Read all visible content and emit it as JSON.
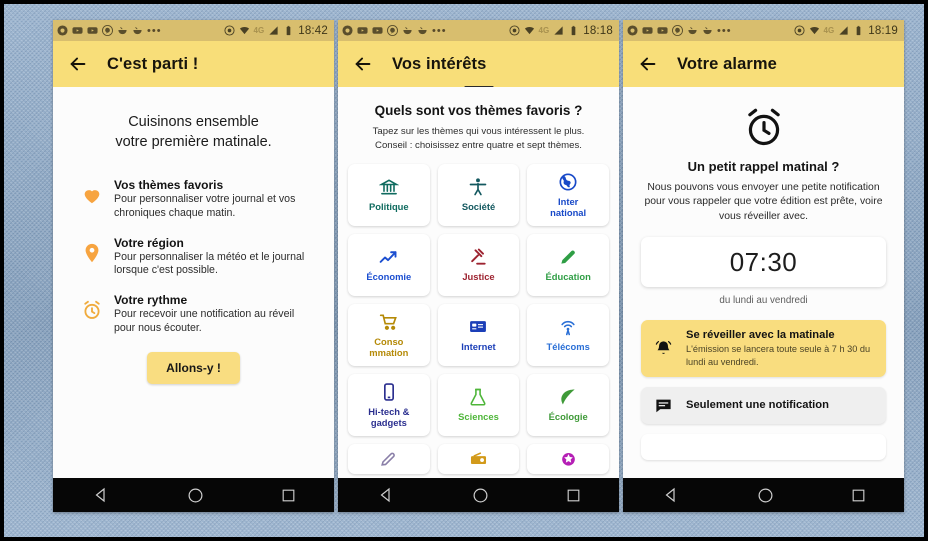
{
  "colors": {
    "accent_yellow": "#f8de79",
    "statusbar_yellow": "#d8be6e",
    "backdrop_blue": "#8fabc9",
    "navbar_black": "#060606"
  },
  "phones": [
    {
      "id": "phone-onboarding-intro",
      "statusbar": {
        "icons": [
          "chrome-icon",
          "youtube-icon",
          "youtube-icon",
          "pinterest-icon",
          "food-bowl-icon",
          "food-bowl-icon",
          "overflow-dots-icon"
        ],
        "network": "4G",
        "right_icons": [
          "do-not-disturb-icon",
          "wifi-icon",
          "signal-icon",
          "battery-icon"
        ],
        "time": "18:42"
      },
      "appbar": {
        "title": "C'est parti !",
        "back": "back-arrow-icon"
      },
      "intro": {
        "heading_line1": "Cuisinons ensemble",
        "heading_line2": "votre première matinale.",
        "features": [
          {
            "icon": "heart-icon",
            "title": "Vos thèmes favoris",
            "description": "Pour personnaliser votre journal et vos chroniques chaque matin."
          },
          {
            "icon": "location-pin-icon",
            "title": "Votre région",
            "description": "Pour personnaliser la météo et le journal lorsque c'est possible."
          },
          {
            "icon": "alarm-clock-icon",
            "title": "Votre rythme",
            "description": "Pour recevoir une notification au réveil pour nous écouter."
          }
        ],
        "cta_label": "Allons-y !"
      }
    },
    {
      "id": "phone-interests",
      "statusbar": {
        "icons": [
          "chrome-icon",
          "youtube-icon",
          "youtube-icon",
          "pinterest-icon",
          "food-bowl-icon",
          "food-bowl-icon",
          "overflow-dots-icon"
        ],
        "network": "4G",
        "right_icons": [
          "do-not-disturb-icon",
          "wifi-icon",
          "signal-icon",
          "battery-icon"
        ],
        "time": "18:18"
      },
      "appbar": {
        "title": "Vos intérêts",
        "back": "back-arrow-icon"
      },
      "interests": {
        "question": "Quels sont vos thèmes favoris ?",
        "hint_line1": "Tapez sur les thèmes qui vous intéressent le plus.",
        "hint_line2": "Conseil : choisissez entre quatre et sept thèmes.",
        "themes": [
          {
            "label": "Politique",
            "icon": "bank-columns-icon",
            "color": "#0f6b5f"
          },
          {
            "label": "Société",
            "icon": "person-icon",
            "color": "#13585f"
          },
          {
            "label": "Inter\nnational",
            "icon": "globe-icon",
            "color": "#1849c8"
          },
          {
            "label": "Économie",
            "icon": "trend-up-arrow-icon",
            "color": "#1b4ed0"
          },
          {
            "label": "Justice",
            "icon": "gavel-icon",
            "color": "#9d2330"
          },
          {
            "label": "Éducation",
            "icon": "pencil-icon",
            "color": "#2f9e45"
          },
          {
            "label": "Conso\nmmation",
            "icon": "shopping-cart-icon",
            "color": "#b58a07"
          },
          {
            "label": "Internet",
            "icon": "monitor-icon",
            "color": "#1b3fb8"
          },
          {
            "label": "Télécoms",
            "icon": "antenna-icon",
            "color": "#2a6fd6"
          },
          {
            "label": "Hi-tech &\ngadgets",
            "icon": "smartphone-icon",
            "color": "#2b2f8f"
          },
          {
            "label": "Sciences",
            "icon": "flask-icon",
            "color": "#4fb63a"
          },
          {
            "label": "Écologie",
            "icon": "leaf-icon",
            "color": "#3f9a38"
          }
        ],
        "partial_row_icons": [
          {
            "icon": "pen-nib-icon",
            "color": "#8a7fa8"
          },
          {
            "icon": "radio-icon",
            "color": "#d29a1a"
          },
          {
            "icon": "star-badge-icon",
            "color": "#b51fb5"
          }
        ]
      }
    },
    {
      "id": "phone-alarm",
      "statusbar": {
        "icons": [
          "chrome-icon",
          "youtube-icon",
          "youtube-icon",
          "pinterest-icon",
          "food-bowl-icon",
          "food-bowl-icon",
          "overflow-dots-icon"
        ],
        "network": "4G",
        "right_icons": [
          "do-not-disturb-icon",
          "wifi-icon",
          "signal-icon",
          "battery-icon"
        ],
        "time": "18:19"
      },
      "appbar": {
        "title": "Votre alarme",
        "back": "back-arrow-icon"
      },
      "alarm": {
        "heading": "Un petit rappel matinal ?",
        "description": "Nous pouvons vous envoyer une petite notification pour vous rappeler que votre édition est prête, voire vous réveiller avec.",
        "time_value": "07:30",
        "time_note": "du lundi au vendredi",
        "options": [
          {
            "icon": "bell-ringing-icon",
            "title": "Se réveiller avec la matinale",
            "subtitle": "L'émission se lancera toute seule à 7 h 30 du lundi au vendredi.",
            "selected": true
          },
          {
            "icon": "chat-notification-icon",
            "title": "Seulement une notification",
            "subtitle": "",
            "selected": false
          }
        ]
      }
    }
  ],
  "navbar": {
    "back_icon": "nav-back-triangle-icon",
    "home_icon": "nav-home-circle-icon",
    "recents_icon": "nav-recents-square-icon"
  }
}
